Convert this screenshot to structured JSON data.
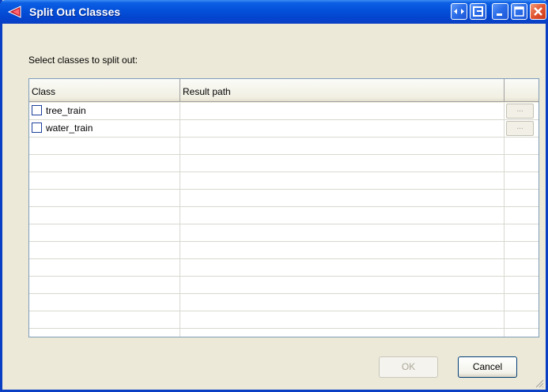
{
  "window": {
    "title": "Split Out Classes",
    "icon": "app-icon",
    "controls": [
      "swap-icon",
      "restore-icon",
      "minimize-icon",
      "maximize-icon",
      "close-icon"
    ]
  },
  "dialog": {
    "prompt": "Select classes to split out:",
    "columns": {
      "class": "Class",
      "result_path": "Result path",
      "browse": ""
    },
    "rows": [
      {
        "checked": false,
        "class": "tree_train",
        "result_path": "",
        "browse_label": "..."
      },
      {
        "checked": false,
        "class": "water_train",
        "result_path": "",
        "browse_label": "..."
      }
    ],
    "buttons": {
      "ok": "OK",
      "cancel": "Cancel"
    }
  },
  "colors": {
    "title_bar": "#0450d9",
    "close_button": "#e2542f",
    "dialog_bg": "#ece9d8",
    "grid_border": "#7f9db9"
  }
}
